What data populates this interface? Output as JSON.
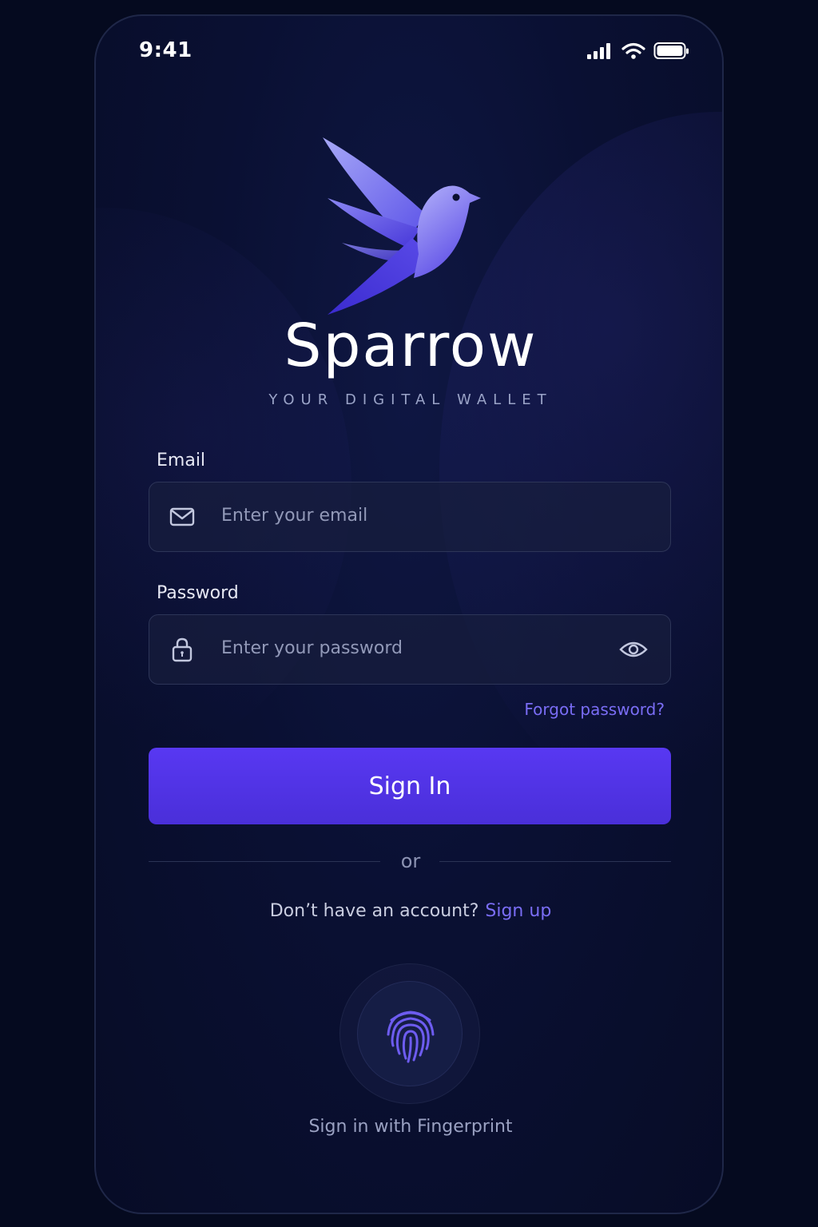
{
  "status_bar": {
    "time": "9:41",
    "icons": [
      "signal-icon",
      "wifi-icon",
      "battery-icon"
    ]
  },
  "brand": {
    "name": "Sparrow",
    "tagline": "YOUR DIGITAL WALLET",
    "logo": "sparrow-bird-logo"
  },
  "form": {
    "email": {
      "label": "Email",
      "value": "",
      "placeholder": "Enter your email",
      "icon": "mail-icon"
    },
    "password": {
      "label": "Password",
      "value": "",
      "placeholder": "Enter your password",
      "icon": "lock-icon",
      "toggle_icon": "eye-icon"
    },
    "forgot_label": "Forgot password?",
    "signin_label": "Sign In",
    "divider_label": "or"
  },
  "signup": {
    "question": "Don’t have an account?",
    "link_label": "Sign up"
  },
  "fingerprint": {
    "icon": "fingerprint-icon",
    "label": "Sign in with Fingerprint"
  },
  "colors": {
    "background": "#050a1f",
    "accent": "#5838f2",
    "link": "#7a6df5"
  }
}
